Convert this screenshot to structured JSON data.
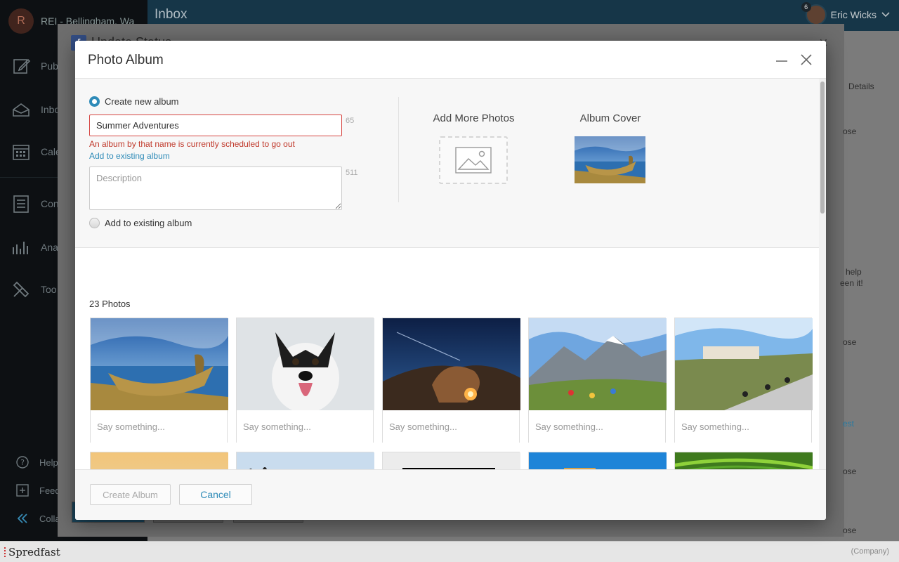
{
  "app": {
    "account_initial": "R",
    "account_name": "REI - Bellingham, Wa",
    "page_title": "Inbox",
    "user_name": "Eric Wicks",
    "notification_count": "6",
    "sidebar": {
      "items": [
        {
          "label": "Pub",
          "icon": "publish-icon"
        },
        {
          "label": "Inbo",
          "icon": "inbox-icon"
        },
        {
          "label": "Cale",
          "icon": "calendar-icon"
        },
        {
          "label": "Con",
          "icon": "content-icon"
        },
        {
          "label": "Ana",
          "icon": "analytics-icon"
        },
        {
          "label": "Too",
          "icon": "tools-icon"
        }
      ],
      "bottom": [
        {
          "label": "Help",
          "icon": "help-icon"
        },
        {
          "label": "Feed",
          "icon": "feedback-icon"
        },
        {
          "label": "Colla",
          "icon": "collapse-icon"
        }
      ]
    },
    "underlying_dialog_title": "Update Status",
    "right_column_header": "Details",
    "right_snippets": [
      "ose",
      "help",
      "een it!",
      "ose",
      "est",
      "ose",
      "ose"
    ],
    "footer_brand": "Spredfast",
    "footer_company": "(Company)"
  },
  "modal": {
    "title": "Photo Album",
    "create_new_label": "Create new album",
    "album_name_value": "Summer Adventures",
    "album_name_counter": "65",
    "error_text": "An album by that name is currently scheduled to go out",
    "add_existing_link": "Add to existing album",
    "description_placeholder": "Description",
    "description_counter": "511",
    "add_existing_label": "Add to existing album",
    "add_more_photos_label": "Add More Photos",
    "album_cover_label": "Album Cover",
    "photos_count": "23 Photos",
    "caption_placeholder": "Say something...",
    "create_button": "Create Album",
    "cancel_button": "Cancel"
  },
  "photos": [
    {
      "subject": "reed boat on lake"
    },
    {
      "subject": "dog in snow"
    },
    {
      "subject": "desert campfire night"
    },
    {
      "subject": "mountain picnic"
    },
    {
      "subject": "cyclists on road"
    },
    {
      "subject": "hill town at sunset"
    },
    {
      "subject": "penguins"
    },
    {
      "subject": "REI logo"
    },
    {
      "subject": "colorful buildings"
    },
    {
      "subject": "rice terraces"
    }
  ],
  "colors": {
    "accent": "#2e8bb8",
    "error": "#c0392b",
    "topbar": "#1a3e52",
    "sidebar": "#0f1316"
  }
}
